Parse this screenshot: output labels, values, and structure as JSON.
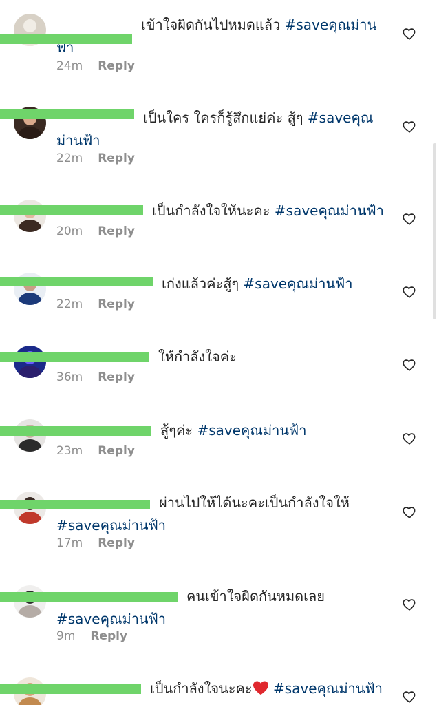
{
  "colors": {
    "text": "#262626",
    "hashtag": "#00376b",
    "meta": "#8e8e8e",
    "redaction": "#6fd46a",
    "heart_emoji": "#e0282e"
  },
  "reply_label": "Reply",
  "comments": [
    {
      "username": "",
      "text": "เข้าใจผิดกันไปหมดแล้ว",
      "hashtag": "#saveคุณม่านฟ้า",
      "time": "24m",
      "avatar_colors": [
        "#d8d1c6",
        "#f1ede6",
        "#efe8dd"
      ]
    },
    {
      "username": "",
      "text": "เป็นใคร ใครก็รู้สึกแย่ค่ะ สู้ๆ",
      "hashtag": "#saveคุณม่านฟ้า",
      "time": "22m",
      "avatar_colors": [
        "#3a2a22",
        "#d9a98c",
        "#2a1c16"
      ]
    },
    {
      "username": "",
      "text": "เป็นกำลังใจให้นะคะ",
      "hashtag": "#saveคุณม่านฟ้า",
      "time": "20m",
      "avatar_colors": [
        "#ece7e1",
        "#e2b9a0",
        "#3b2a22"
      ]
    },
    {
      "username": "",
      "text": "เก่งแล้วค่ะสู้ๆ",
      "hashtag": "#saveคุณม่านฟ้า",
      "time": "22m",
      "avatar_colors": [
        "#e9eef4",
        "#c99e86",
        "#1c3a7a"
      ]
    },
    {
      "username": "",
      "text": "ให้กำลังใจค่ะ",
      "hashtag": "",
      "time": "36m",
      "avatar_colors": [
        "#1b2a8a",
        "#6a5cff",
        "#2c1f6d"
      ]
    },
    {
      "username": "",
      "text": "สู้ๆค่ะ",
      "hashtag": "#saveคุณม่านฟ้า",
      "time": "23m",
      "avatar_colors": [
        "#e6e4e2",
        "#c9b1a2",
        "#2b2b2b"
      ]
    },
    {
      "username": "",
      "text": "ผ่านไปให้ได้นะคะเป็นกำลังใจให้",
      "hashtag": "#saveคุณม่านฟ้า",
      "time": "17m",
      "avatar_colors": [
        "#ece9e6",
        "#3a2b25",
        "#c0392b"
      ]
    },
    {
      "username": "",
      "text": "คนเข้าใจผิดกันหมดเลย",
      "hashtag": "#saveคุณม่านฟ้า",
      "time": "9m",
      "avatar_colors": [
        "#f0efee",
        "#2c2c2c",
        "#b5aca6"
      ]
    },
    {
      "username": "",
      "text": "เป็นกำลังใจนะคะ",
      "hashtag": "#saveคุณม่านฟ้า",
      "time": "",
      "avatar_colors": [
        "#efe6da",
        "#d7a47a",
        "#c28a4f"
      ]
    }
  ]
}
